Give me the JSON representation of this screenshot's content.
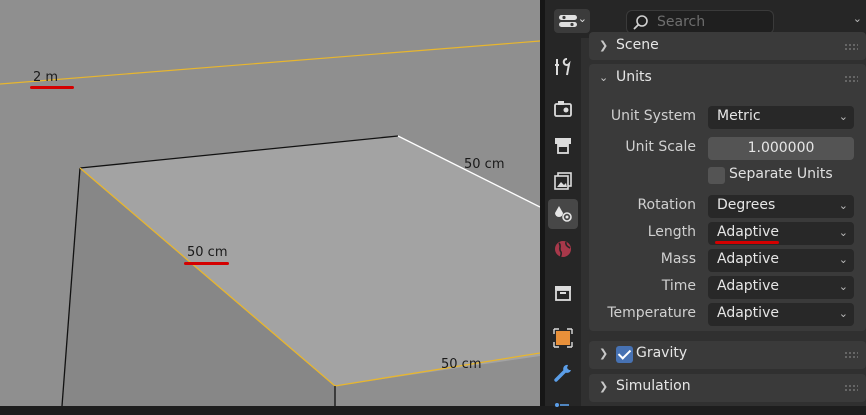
{
  "viewport": {
    "dimensions": [
      {
        "name": "grid",
        "text": "2 m"
      },
      {
        "name": "edge-front",
        "text": "50 cm"
      },
      {
        "name": "edge-right",
        "text": "50 cm"
      },
      {
        "name": "edge-bottom",
        "text": "50 cm"
      }
    ]
  },
  "header": {
    "editor_type_icon": "properties-editor-icon",
    "search_placeholder": "Search",
    "pin_icon": "chevron-down-icon"
  },
  "tabs": [
    {
      "name": "tool",
      "icon": "wrench-screwdriver-icon",
      "active": false
    },
    {
      "name": "render",
      "icon": "camera-back-icon",
      "active": false
    },
    {
      "name": "output",
      "icon": "printer-icon",
      "active": false
    },
    {
      "name": "view-layer",
      "icon": "images-icon",
      "active": false
    },
    {
      "name": "scene",
      "icon": "scene-icon",
      "active": true
    },
    {
      "name": "world",
      "icon": "world-icon",
      "active": false
    },
    {
      "name": "collection",
      "icon": "box-icon",
      "active": false
    },
    {
      "name": "object",
      "icon": "object-icon",
      "active": false
    },
    {
      "name": "modifiers",
      "icon": "wrench-icon",
      "active": false
    },
    {
      "name": "particles",
      "icon": "particles-icon",
      "active": false
    }
  ],
  "panels": {
    "scene": {
      "title": "Scene",
      "expanded": false
    },
    "units": {
      "title": "Units",
      "expanded": true,
      "unit_system_label": "Unit System",
      "unit_system_value": "Metric",
      "unit_scale_label": "Unit Scale",
      "unit_scale_value": "1.000000",
      "separate_units_label": "Separate Units",
      "separate_units_checked": false,
      "rotation_label": "Rotation",
      "rotation_value": "Degrees",
      "length_label": "Length",
      "length_value": "Adaptive",
      "mass_label": "Mass",
      "mass_value": "Adaptive",
      "time_label": "Time",
      "time_value": "Adaptive",
      "temperature_label": "Temperature",
      "temperature_value": "Adaptive"
    },
    "gravity": {
      "title": "Gravity",
      "expanded": false,
      "enabled": true
    },
    "simulation": {
      "title": "Simulation",
      "expanded": false
    }
  },
  "colors": {
    "viewport_bg": "#8f8f8f",
    "selected_edge": "#e8b62e",
    "annotation_red": "#d40000",
    "checkbox_blue": "#4772b3"
  }
}
